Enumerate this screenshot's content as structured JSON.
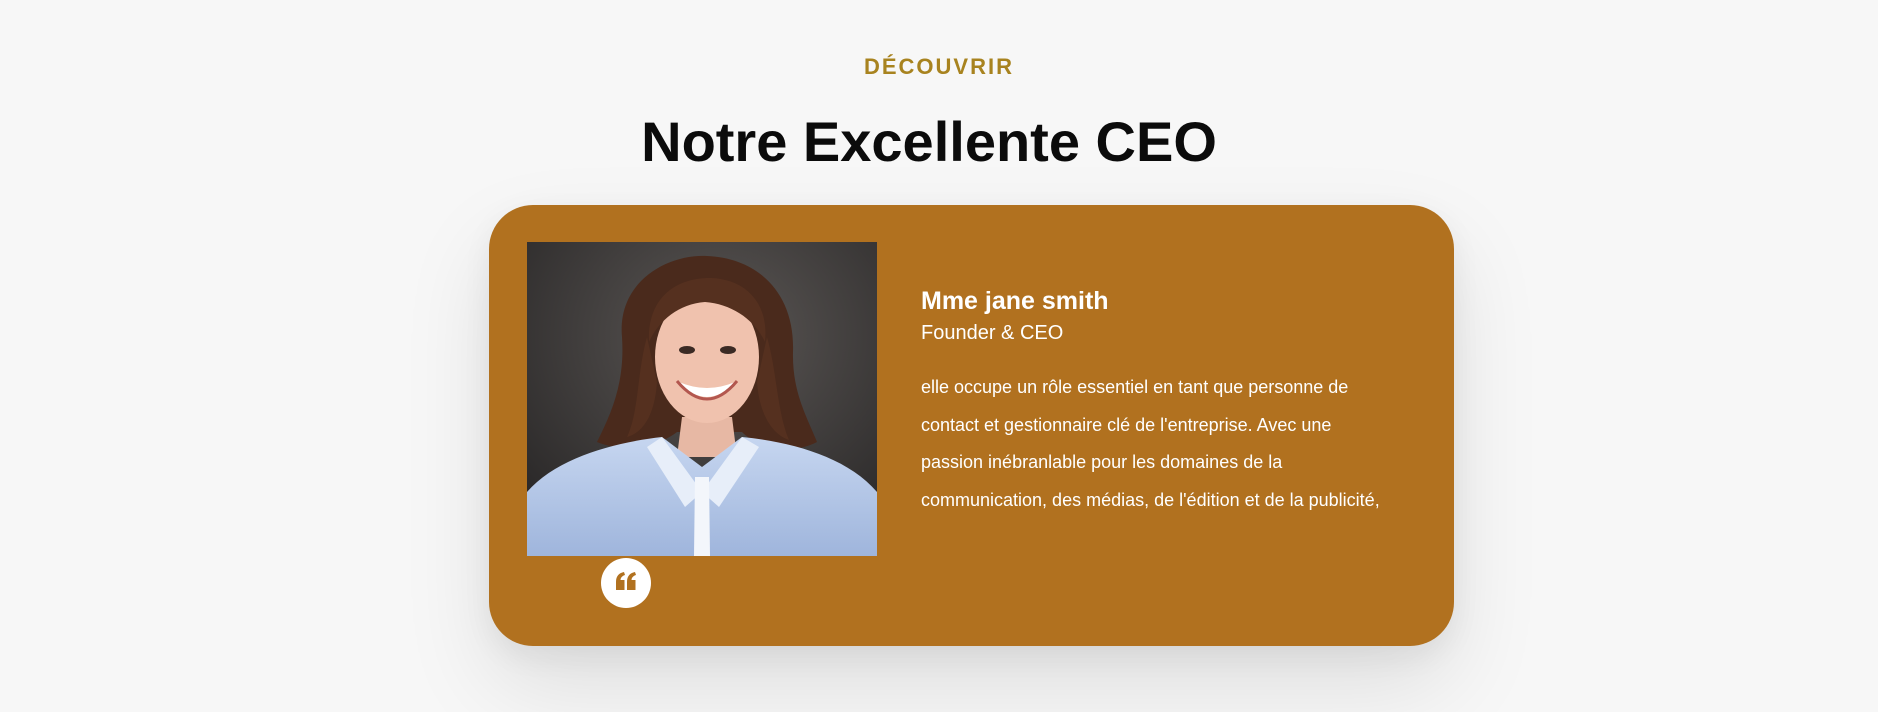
{
  "section": {
    "eyebrow": "DÉCOUVRIR",
    "title": "Notre Excellente CEO"
  },
  "profile": {
    "name": "Mme jane smith",
    "role": "Founder & CEO",
    "bio": "elle occupe un rôle essentiel en tant que personne de contact et gestionnaire clé de l'entreprise. Avec une passion inébranlable pour les domaines de la communication, des médias, de l'édition et de la publicité,",
    "photo_alt": "Portrait of Mme jane smith",
    "quote_icon": "quote-left-icon"
  },
  "colors": {
    "accent": "#b1711f",
    "eyebrow": "#a8831f",
    "background": "#f7f7f7",
    "title": "#0b0b0b"
  }
}
